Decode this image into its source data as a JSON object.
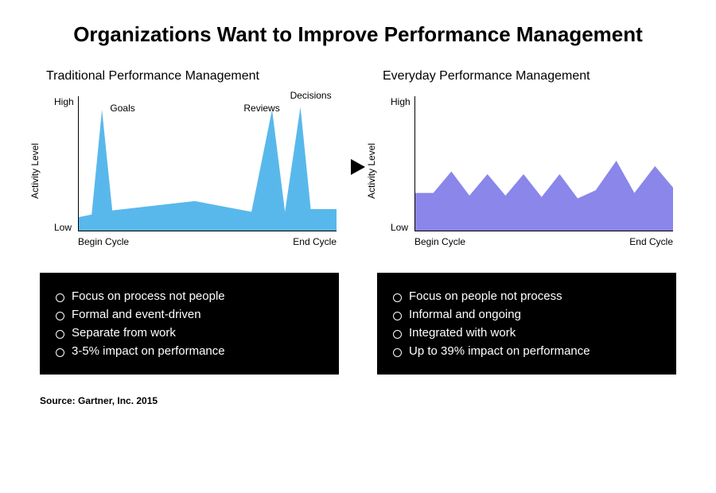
{
  "title": "Organizations Want to Improve Performance Management",
  "source": "Source: Gartner, Inc. 2015",
  "left": {
    "subtitle": "Traditional Performance Management",
    "ylabel": "Activity Level",
    "ytick_high": "High",
    "ytick_low": "Low",
    "xtick_left": "Begin Cycle",
    "xtick_right": "End Cycle",
    "peaks": {
      "goals": "Goals",
      "reviews": "Reviews",
      "decisions": "Decisions"
    },
    "bullets": [
      "Focus on process not people",
      "Formal and event-driven",
      "Separate from work",
      "3-5% impact on performance"
    ]
  },
  "right": {
    "subtitle": "Everyday Performance Management",
    "ylabel": "Activity Level",
    "ytick_high": "High",
    "ytick_low": "Low",
    "xtick_left": "Begin Cycle",
    "xtick_right": "End Cycle",
    "bullets": [
      "Focus on people not process",
      "Informal and ongoing",
      "Integrated with work",
      "Up to 39% impact on performance"
    ]
  },
  "chart_data": [
    {
      "type": "area",
      "title": "Traditional Performance Management",
      "xlabel": "",
      "ylabel": "Activity Level",
      "x_ticks": [
        "Begin Cycle",
        "End Cycle"
      ],
      "y_ticks": [
        "Low",
        "High"
      ],
      "ylim": [
        0,
        100
      ],
      "color": "#59b8eb",
      "annotations": [
        {
          "x": 9,
          "y": 90,
          "text": "Goals"
        },
        {
          "x": 75,
          "y": 90,
          "text": "Reviews"
        },
        {
          "x": 86,
          "y": 92,
          "text": "Decisions"
        }
      ],
      "series": [
        {
          "name": "Activity",
          "x": [
            0,
            5,
            9,
            13,
            45,
            67,
            75,
            80,
            86,
            90,
            100
          ],
          "y": [
            10,
            12,
            90,
            15,
            22,
            14,
            90,
            14,
            92,
            16,
            16
          ]
        }
      ]
    },
    {
      "type": "area",
      "title": "Everyday Performance Management",
      "xlabel": "",
      "ylabel": "Activity Level",
      "x_ticks": [
        "Begin Cycle",
        "End Cycle"
      ],
      "y_ticks": [
        "Low",
        "High"
      ],
      "ylim": [
        0,
        100
      ],
      "color": "#8a86ea",
      "series": [
        {
          "name": "Activity",
          "x": [
            0,
            7,
            14,
            21,
            28,
            35,
            42,
            49,
            56,
            63,
            70,
            78,
            85,
            93,
            100
          ],
          "y": [
            28,
            28,
            44,
            26,
            42,
            26,
            42,
            25,
            42,
            24,
            30,
            52,
            28,
            48,
            32
          ]
        }
      ]
    }
  ]
}
